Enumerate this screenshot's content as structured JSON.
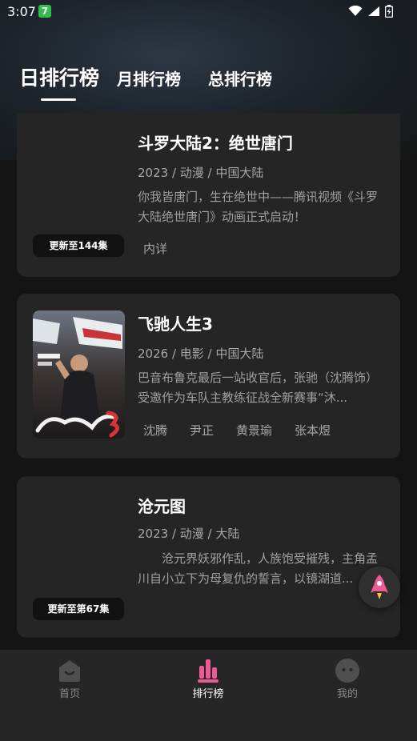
{
  "status_bar": {
    "time": "3:07",
    "app_badge": "7",
    "icons": [
      "wifi-icon",
      "signal-icon",
      "battery-charging-icon"
    ]
  },
  "tabs": [
    {
      "label": "日排行榜",
      "active": true
    },
    {
      "label": "月排行榜",
      "active": false
    },
    {
      "label": "总排行榜",
      "active": false
    }
  ],
  "items": [
    {
      "title": "斗罗大陆2：绝世唐门",
      "meta": "2023 / 动漫 / 中国大陆",
      "desc": "你我皆唐门，生在绝世中——腾讯视频《斗罗大陆绝世唐门》动画正式启动！",
      "cast": [
        "内详"
      ],
      "badge": "更新至144集"
    },
    {
      "title": "飞驰人生3",
      "meta": "2026 / 电影 / 中国大陆",
      "desc": "巴音布鲁克最后一站收官后，张驰（沈腾饰）受邀作为车队主教练征战全新赛事“沐...",
      "cast": [
        "沈腾",
        "尹正",
        "黄景瑜",
        "张本煜"
      ],
      "poster_text": "飞驰人生3"
    },
    {
      "title": "沧元图",
      "meta": "2023 / 动漫 / 大陆",
      "desc": "　　沧元界妖邪作乱，人族饱受摧残，主角孟川自小立下为母复仇的誓言，以镜湖道...",
      "badge": "更新至第67集"
    }
  ],
  "fab": {
    "icon": "rocket-icon"
  },
  "bottom_nav": [
    {
      "label": "首页",
      "icon": "home-icon",
      "active": false
    },
    {
      "label": "排行榜",
      "icon": "ranking-icon",
      "active": true
    },
    {
      "label": "我的",
      "icon": "profile-icon",
      "active": false
    }
  ],
  "colors": {
    "background": "#141414",
    "card": "#252525",
    "accent_pink": "#ee5a93",
    "nav_bg": "#262626"
  }
}
